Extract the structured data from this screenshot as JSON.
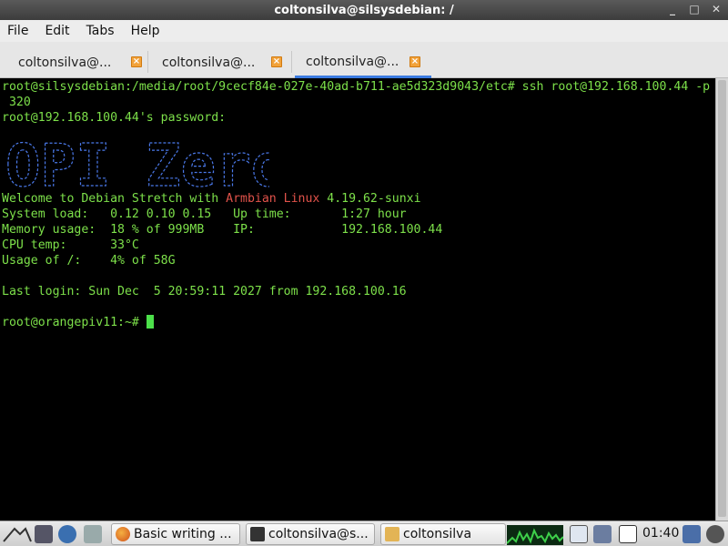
{
  "window": {
    "title": "coltonsilva@silsysdebian: /"
  },
  "menu": [
    "File",
    "Edit",
    "Tabs",
    "Help"
  ],
  "tabs": [
    {
      "label": "coltonsilva@..."
    },
    {
      "label": "coltonsilva@..."
    },
    {
      "label": "coltonsilva@..."
    }
  ],
  "terminal": {
    "lines": [
      "root@silsysdebian:/media/root/9cecf84e-027e-40ad-b711-ae5d323d9043/etc# ssh root@192.168.100.44 -p",
      " 320",
      "root@192.168.100.44's password:"
    ],
    "logo_text": "OPI Zero",
    "welcome_prefix": "Welcome to Debian Stretch with ",
    "welcome_distro": "Armbian Linux",
    "welcome_suffix": " 4.19.62-sunxi",
    "stats": [
      "System load:   0.12 0.10 0.15   Up time:       1:27 hour",
      "Memory usage:  18 % of 999MB    IP:            192.168.100.44",
      "CPU temp:      33°C",
      "Usage of /:    4% of 58G"
    ],
    "last_login": "Last login: Sun Dec  5 20:59:11 2027 from 192.168.100.16",
    "prompt": "root@orangepiv11:~# "
  },
  "taskbar": {
    "tasks": [
      {
        "label": "Basic writing ...",
        "icon": "firefox-icon"
      },
      {
        "label": "coltonsilva@s...",
        "icon": "terminal-icon"
      },
      {
        "label": "coltonsilva",
        "icon": "folder-icon"
      }
    ],
    "clock": "01:40"
  },
  "colors": {
    "terminal_fg": "#7de04a",
    "accent": "#3b7be0",
    "red": "#e0524a"
  }
}
